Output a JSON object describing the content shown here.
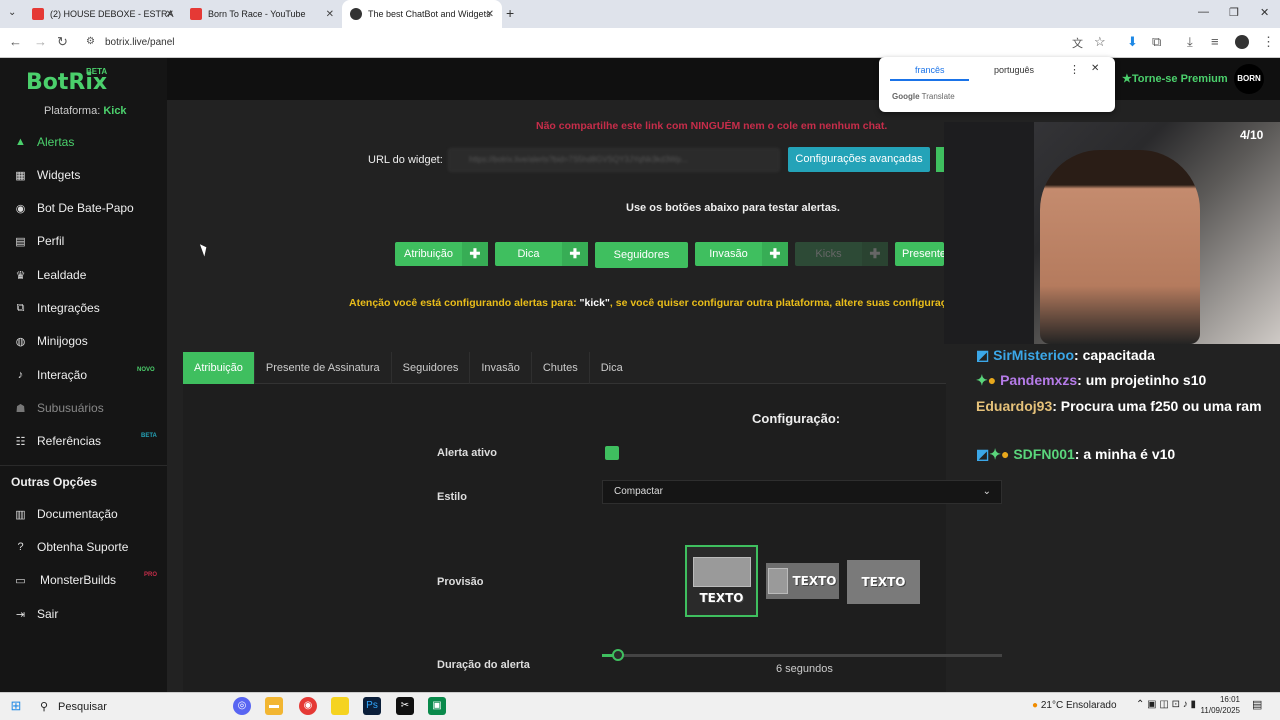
{
  "browser": {
    "tabs": [
      {
        "title": "(2) HOUSE DEBOXE - ESTRA"
      },
      {
        "title": "Born To Race - YouTube"
      },
      {
        "title": "The best ChatBot and Widgets"
      }
    ],
    "url": "botrix.live/panel",
    "translate": {
      "lang1": "francês",
      "lang2": "português",
      "brand": "Google",
      "product": "Translate"
    }
  },
  "app": {
    "logo": "BotRix",
    "logo_badge": "BETA",
    "platform_label": "Plataforma:",
    "platform_value": "Kick",
    "premium": "Torne-se Premium",
    "avatar_text": "BORN"
  },
  "sidebar": {
    "items": [
      {
        "label": "Alertas",
        "icon": "warning-icon"
      },
      {
        "label": "Widgets",
        "icon": "grid-icon"
      },
      {
        "label": "Bot De Bate-Papo",
        "icon": "robot-icon"
      },
      {
        "label": "Perfil",
        "icon": "id-card-icon"
      },
      {
        "label": "Lealdade",
        "icon": "trophy-icon"
      },
      {
        "label": "Integrações",
        "icon": "external-link-icon"
      },
      {
        "label": "Minijogos",
        "icon": "gamepad-icon"
      },
      {
        "label": "Interação",
        "icon": "music-icon",
        "badge": "NOVO"
      },
      {
        "label": "Subusuários",
        "icon": "users-icon"
      },
      {
        "label": "Referências",
        "icon": "people-icon",
        "badge": "BETA"
      }
    ],
    "other_title": "Outras Opções",
    "other_items": [
      {
        "label": "Documentação",
        "icon": "book-icon"
      },
      {
        "label": "Obtenha Suporte",
        "icon": "question-icon"
      },
      {
        "label": "MonsterBuilds",
        "icon": "monitor-icon",
        "badge": "PRO"
      },
      {
        "label": "Sair",
        "icon": "logout-icon"
      }
    ]
  },
  "main": {
    "warning": "Não compartilhe este link com NINGUÉM nem o cole em nenhum chat.",
    "widget_url_label": "URL do widget:",
    "widget_url_value": "https://botrix.live/alerts?bid=7S5hd8GVSQY3JYqNk3kd3Wp...",
    "advanced_button": "Configurações avançadas",
    "test_hint": "Use os botões abaixo para testar alertas.",
    "test_buttons": [
      "Atribuição",
      "Dica",
      "Seguidores",
      "Invasão",
      "Kicks",
      "Presente"
    ],
    "attention_prefix": "Atenção você está configurando alertas para:",
    "attention_platform": "\"kick\"",
    "attention_suffix": ", se você quiser configurar outra plataforma, altere suas configurações",
    "tabs": [
      "Atribuição",
      "Presente de Assinatura",
      "Seguidores",
      "Invasão",
      "Chutes",
      "Dica"
    ],
    "config_title": "Configuração:",
    "alert_active_label": "Alerta ativo",
    "style_label": "Estilo",
    "style_value": "Compactar",
    "provision_label": "Provisão",
    "provision_text": "TEXTO",
    "duration_label": "Duração do alerta",
    "duration_value": "6 segundos",
    "duration_fraction": 0.04
  },
  "stream": {
    "counter": "4/10",
    "chat": [
      {
        "user": "SirMisterioo",
        "msg": ": capacitada"
      },
      {
        "user": "Pandemxzs",
        "msg": ": um projetinho s10"
      },
      {
        "user": "Eduardoj93",
        "msg": ": Procura uma f250 ou uma ram"
      },
      {
        "user": "SDFN001",
        "msg": ": a minha é v10"
      }
    ]
  },
  "taskbar": {
    "search": "Pesquisar",
    "weather": "21°C",
    "weather_desc": "Ensolarado",
    "time": "16:01",
    "date": "11/09/2025"
  }
}
